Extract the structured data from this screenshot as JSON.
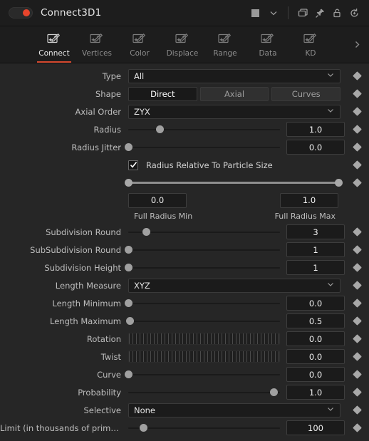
{
  "titlebar": {
    "node_name": "Connect3D1",
    "toggle_color": "#e8452c",
    "icons": [
      "color-swatch",
      "chevron-down-icon",
      "duplicate-icon",
      "pin-icon",
      "lock-icon",
      "reset-icon"
    ]
  },
  "tabs": {
    "more_icon": "chevron-right-icon",
    "items": [
      {
        "label": "Connect",
        "active": true
      },
      {
        "label": "Vertices",
        "active": false
      },
      {
        "label": "Color",
        "active": false
      },
      {
        "label": "Displace",
        "active": false
      },
      {
        "label": "Range",
        "active": false
      },
      {
        "label": "Data",
        "active": false
      },
      {
        "label": "KD",
        "active": false
      }
    ]
  },
  "params": {
    "type": {
      "label": "Type",
      "value": "All"
    },
    "shape": {
      "label": "Shape",
      "options": [
        "Direct",
        "Axial",
        "Curves"
      ],
      "selected": "Direct"
    },
    "axial_order": {
      "label": "Axial Order",
      "value": "ZYX"
    },
    "radius": {
      "label": "Radius",
      "value": "1.0",
      "pos": 21
    },
    "radius_jitter": {
      "label": "Radius Jitter",
      "value": "0.0",
      "pos": 0
    },
    "radius_relative": {
      "label": "Radius Relative To Particle Size",
      "checked": true
    },
    "full_radius": {
      "min": "0.0",
      "max": "1.0",
      "min_caption": "Full Radius Min",
      "max_caption": "Full Radius Max",
      "min_pos": 0,
      "max_pos": 100
    },
    "subdiv_round": {
      "label": "Subdivision Round",
      "value": "3",
      "pos": 12
    },
    "subsubdiv_round": {
      "label": "SubSubdivision Round",
      "value": "1",
      "pos": 0
    },
    "subdiv_height": {
      "label": "Subdivision Height",
      "value": "1",
      "pos": 0
    },
    "length_measure": {
      "label": "Length Measure",
      "value": "XYZ"
    },
    "length_minimum": {
      "label": "Length Minimum",
      "value": "0.0",
      "pos": 0
    },
    "length_maximum": {
      "label": "Length Maximum",
      "value": "0.5",
      "pos": 1
    },
    "rotation": {
      "label": "Rotation",
      "value": "0.0"
    },
    "twist": {
      "label": "Twist",
      "value": "0.0"
    },
    "curve": {
      "label": "Curve",
      "value": "0.0",
      "pos": 0
    },
    "probability": {
      "label": "Probability",
      "value": "1.0",
      "pos": 96
    },
    "selective": {
      "label": "Selective",
      "value": "None"
    },
    "limit": {
      "label": "Limit (in thousands of primitiv…",
      "value": "100",
      "pos": 10
    }
  }
}
